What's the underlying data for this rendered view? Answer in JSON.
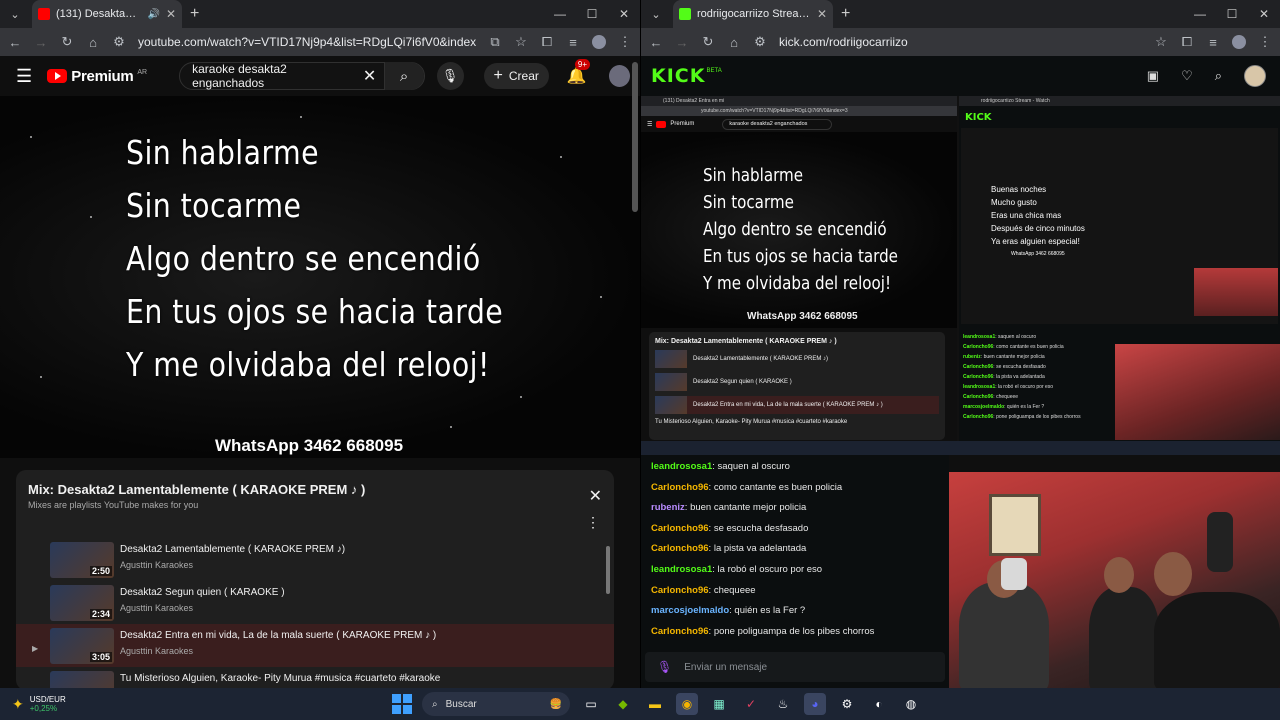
{
  "left_window": {
    "tab_title": "(131) Desakta2 Entra en mi",
    "url": "youtube.com/watch?v=VTID17Nj9p4&list=RDgLQi7i6fV0&index=3",
    "yt": {
      "brand": "Premium",
      "country": "AR",
      "search_query": "karaoke desakta2 enganchados",
      "create_label": "Crear",
      "notif_count": "9+"
    },
    "lyrics": [
      "Sin hablarme",
      "Sin tocarme",
      "Algo dentro se encendió",
      "En tus ojos se hacia tarde",
      "Y me olvidaba del relooj!"
    ],
    "whatsapp": "WhatsApp 3462 668095",
    "mix": {
      "title": "Mix: Desakta2 Lamentablemente ( KARAOKE PREM ♪ )",
      "subtitle": "Mixes are playlists YouTube makes for you",
      "items": [
        {
          "title": "Desakta2 Lamentablemente ( KARAOKE PREM ♪)",
          "channel": "Agusttin Karaokes",
          "duration": "2:50"
        },
        {
          "title": "Desakta2 Segun quien ( KARAOKE )",
          "channel": "Agusttin Karaokes",
          "duration": "2:34"
        },
        {
          "title": "Desakta2 Entra en mi vida, La de la mala suerte ( KARAOKE PREM ♪ )",
          "channel": "Agusttin Karaokes",
          "duration": "3:05"
        },
        {
          "title": "Tu Misterioso Alguien, Karaoke- Pity Murua #musica #cuarteto #karaoke",
          "channel": "",
          "duration": ""
        }
      ]
    }
  },
  "right_window": {
    "tab_title": "rodriigocarriizo Stream - Watch",
    "url": "kick.com/rodriigocarriizo",
    "kick": {
      "logo": "KICK",
      "beta": "BETA"
    },
    "chat": [
      {
        "user": "leandrososa1",
        "text": "saquen al oscuro",
        "color": "#53fc18"
      },
      {
        "user": "Carloncho96",
        "text": "como cantante es buen policia",
        "color": "#f5b700"
      },
      {
        "user": "rubeniz",
        "text": "buen cantante mejor policia",
        "color": "#b98cff"
      },
      {
        "user": "Carloncho96",
        "text": "se escucha desfasado",
        "color": "#f5b700"
      },
      {
        "user": "Carloncho96",
        "text": "la pista va adelantada",
        "color": "#f5b700"
      },
      {
        "user": "leandrososa1",
        "text": "la robó el oscuro por eso",
        "color": "#53fc18"
      },
      {
        "user": "Carloncho96",
        "text": "chequeee",
        "color": "#f5b700"
      },
      {
        "user": "marcosjoelmaldo",
        "text": "quién es la Fer ?",
        "color": "#6ab4ff"
      },
      {
        "user": "Carloncho96",
        "text": "pone poliguampa de los pibes chorros",
        "color": "#f5b700"
      }
    ],
    "chat_placeholder": "Enviar un mensaje",
    "nested_lyrics": [
      "Buenas noches",
      "Mucho gusto",
      "Eras una chica mas",
      "Después de cinco minutos",
      "Ya eras alguien especial!"
    ],
    "nested_whatsapp": "WhatsApp 3462 668095"
  },
  "taskbar": {
    "weather_label": "USD/EUR",
    "weather_value": "+0,25%",
    "search_label": "Buscar"
  }
}
